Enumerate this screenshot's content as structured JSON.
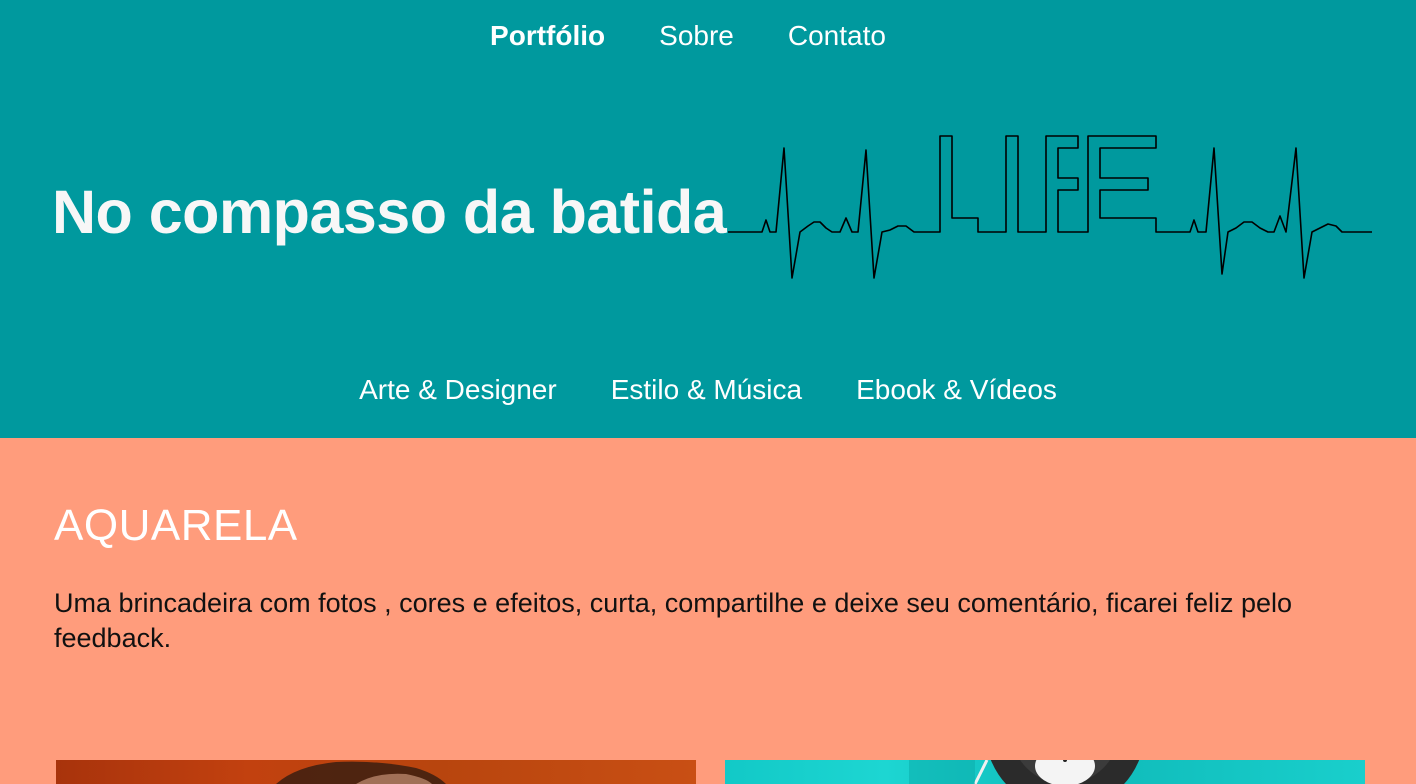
{
  "top_nav": {
    "items": [
      {
        "label": "Portfólio"
      },
      {
        "label": "Sobre"
      },
      {
        "label": "Contato"
      }
    ]
  },
  "brand": {
    "title": "No compasso da batida",
    "logo_text": "LIFE"
  },
  "category_nav": {
    "items": [
      {
        "label": "Arte & Designer"
      },
      {
        "label": "Estilo & Música"
      },
      {
        "label": "Ebook & Vídeos"
      }
    ]
  },
  "section": {
    "heading": "AQUARELA",
    "description": "Uma brincadeira com fotos , cores e efeitos, curta, compartilhe e deixe seu comentário, ficarei feliz pelo feedback."
  },
  "colors": {
    "header_bg": "#00999e",
    "content_bg": "#ff9c7c",
    "heading_text": "#ffffff",
    "body_text": "#111111"
  }
}
